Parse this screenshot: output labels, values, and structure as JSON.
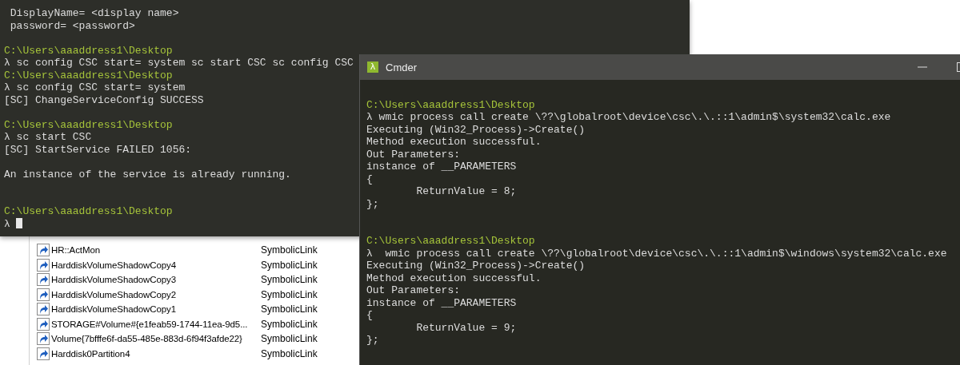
{
  "explorer": {
    "rows": [
      {
        "name": "HR::ActMon",
        "type": "SymbolicLink"
      },
      {
        "name": "HarddiskVolumeShadowCopy4",
        "type": "SymbolicLink"
      },
      {
        "name": "HarddiskVolumeShadowCopy3",
        "type": "SymbolicLink"
      },
      {
        "name": "HarddiskVolumeShadowCopy2",
        "type": "SymbolicLink"
      },
      {
        "name": "HarddiskVolumeShadowCopy1",
        "type": "SymbolicLink"
      },
      {
        "name": "STORAGE#Volume#{e1feab59-1744-11ea-9d5...",
        "type": "SymbolicLink"
      },
      {
        "name": "Volume{7bfffe6f-da55-485e-883d-6f94f3afde22}",
        "type": "SymbolicLink"
      },
      {
        "name": "Harddisk0Partition4",
        "type": "SymbolicLink"
      }
    ]
  },
  "back_terminal": {
    "lines": [
      {
        "kind": "output",
        "text": " DisplayName= <display name>"
      },
      {
        "kind": "output",
        "text": " password= <password>"
      },
      {
        "kind": "gap"
      },
      {
        "kind": "path",
        "text": "C:\\Users\\aaaddress1\\Desktop"
      },
      {
        "kind": "command",
        "text": "λ sc config CSC start= system sc start CSC sc config CSC"
      },
      {
        "kind": "path",
        "text": "C:\\Users\\aaaddress1\\Desktop"
      },
      {
        "kind": "command",
        "text": "λ sc config CSC start= system"
      },
      {
        "kind": "output",
        "text": "[SC] ChangeServiceConfig SUCCESS"
      },
      {
        "kind": "gap"
      },
      {
        "kind": "path",
        "text": "C:\\Users\\aaaddress1\\Desktop"
      },
      {
        "kind": "command",
        "text": "λ sc start CSC"
      },
      {
        "kind": "output",
        "text": "[SC] StartService FAILED 1056:"
      },
      {
        "kind": "gap"
      },
      {
        "kind": "output",
        "text": "An instance of the service is already running."
      },
      {
        "kind": "gap"
      },
      {
        "kind": "gap"
      },
      {
        "kind": "path",
        "text": "C:\\Users\\aaaddress1\\Desktop"
      },
      {
        "kind": "command",
        "text": "λ",
        "cursor": true
      }
    ]
  },
  "cmder_window": {
    "icon": "λ",
    "title": "Cmder",
    "lines": [
      {
        "kind": "gap"
      },
      {
        "kind": "path",
        "text": "C:\\Users\\aaaddress1\\Desktop"
      },
      {
        "kind": "command",
        "text": "λ wmic process call create \\??\\globalroot\\device\\csc\\.\\.::1\\admin$\\system32\\calc.exe"
      },
      {
        "kind": "output",
        "text": "Executing (Win32_Process)->Create()"
      },
      {
        "kind": "output",
        "text": "Method execution successful."
      },
      {
        "kind": "output",
        "text": "Out Parameters:"
      },
      {
        "kind": "output",
        "text": "instance of __PARAMETERS"
      },
      {
        "kind": "output",
        "text": "{"
      },
      {
        "kind": "output",
        "text": "        ReturnValue = 8;"
      },
      {
        "kind": "output",
        "text": "};"
      },
      {
        "kind": "gap"
      },
      {
        "kind": "gap"
      },
      {
        "kind": "path",
        "text": "C:\\Users\\aaaddress1\\Desktop"
      },
      {
        "kind": "command",
        "text": "λ  wmic process call create \\??\\globalroot\\device\\csc\\.\\.::1\\admin$\\windows\\system32\\calc.exe"
      },
      {
        "kind": "output",
        "text": "Executing (Win32_Process)->Create()"
      },
      {
        "kind": "output",
        "text": "Method execution successful."
      },
      {
        "kind": "output",
        "text": "Out Parameters:"
      },
      {
        "kind": "output",
        "text": "instance of __PARAMETERS"
      },
      {
        "kind": "output",
        "text": "{"
      },
      {
        "kind": "output",
        "text": "        ReturnValue = 9;"
      },
      {
        "kind": "output",
        "text": "};"
      }
    ]
  }
}
